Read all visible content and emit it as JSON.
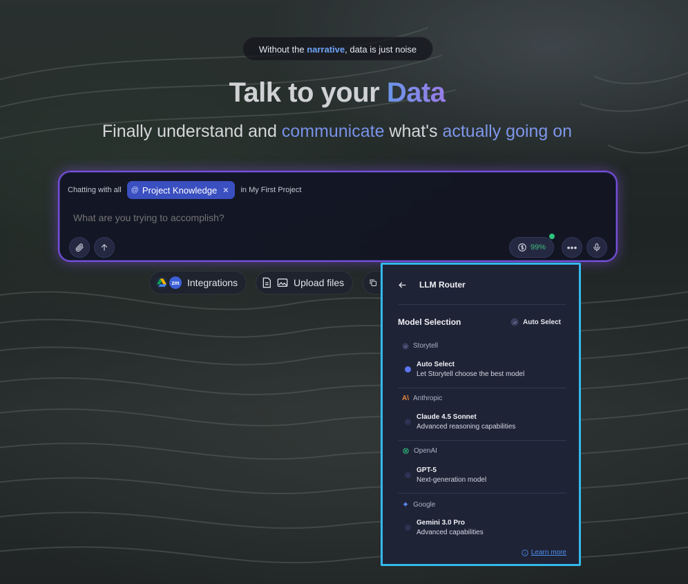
{
  "hero": {
    "tagline_pre": "Without the ",
    "tagline_hl": "narrative",
    "tagline_post": ", data is just noise",
    "title_pre": "Talk to your ",
    "title_hl": "Data",
    "sub_1": "Finally understand and ",
    "sub_2": "communicate",
    "sub_3": " what's ",
    "sub_4": "actually going on"
  },
  "chat": {
    "context_prefix": "Chatting with all",
    "chip_label": "Project Knowledge",
    "context_suffix": "in My First Project",
    "placeholder": "What are you trying to accomplish?",
    "credit": "99%"
  },
  "actions": {
    "integrations": "Integrations",
    "integrations_badge": "zm",
    "upload": "Upload files"
  },
  "router": {
    "title": "LLM Router",
    "section": "Model Selection",
    "current": "Auto Select",
    "providers": [
      {
        "name": "Storytell",
        "icon": "storytell-icon",
        "model": "Auto Select",
        "desc": "Let Storytell choose the best model",
        "selected": true
      },
      {
        "name": "Anthropic",
        "icon": "anthropic-icon",
        "model": "Claude 4.5 Sonnet",
        "desc": "Advanced reasoning capabilities",
        "selected": false
      },
      {
        "name": "OpenAI",
        "icon": "openai-icon",
        "model": "GPT-5",
        "desc": "Next-generation model",
        "selected": false
      },
      {
        "name": "Google",
        "icon": "google-icon",
        "model": "Gemini 3.0 Pro",
        "desc": "Advanced capabilities",
        "selected": false
      }
    ],
    "learn_more": "Learn more"
  },
  "colors": {
    "accent_blue": "#34b9ee",
    "chip": "#3a4fc0",
    "glow": "#7c4dde",
    "credit_green": "#3fbf7f"
  }
}
